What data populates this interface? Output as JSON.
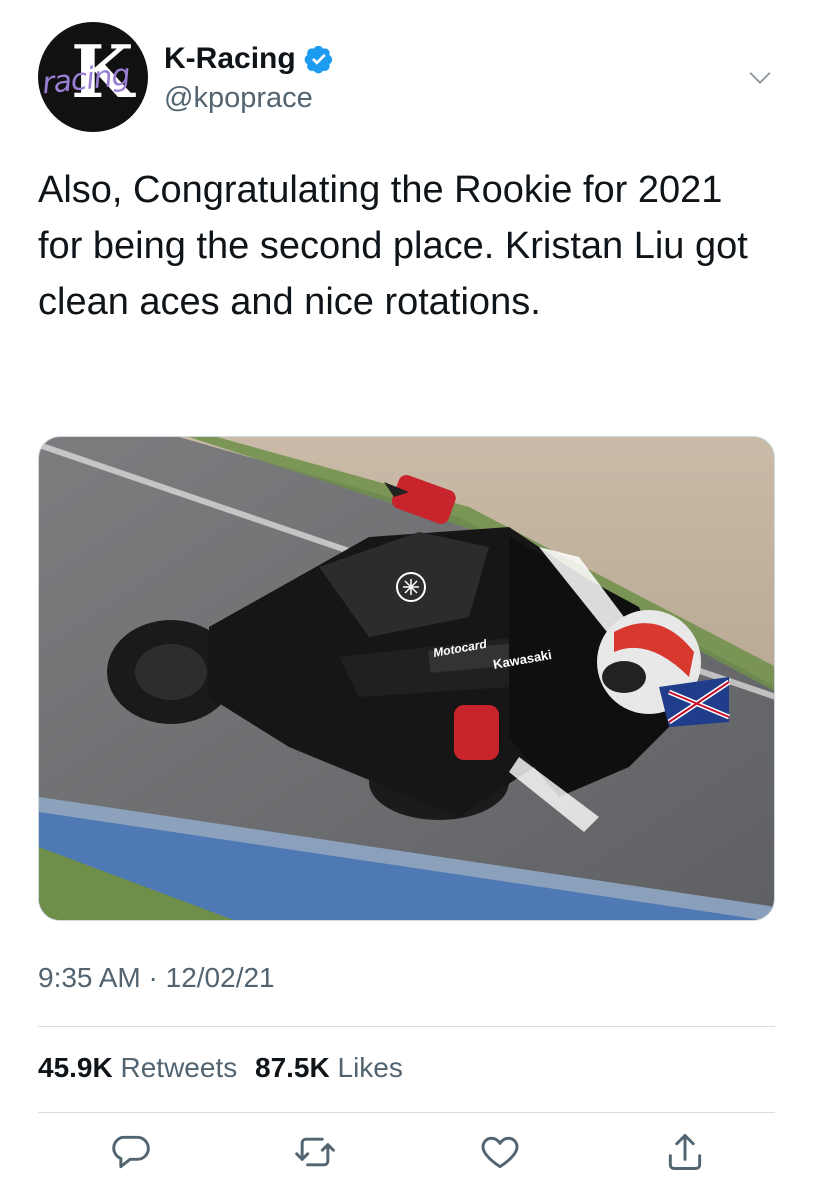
{
  "tweet": {
    "display_name": "K-Racing",
    "handle": "@kpoprace",
    "avatar_logo_letter": "K",
    "avatar_logo_word": "racing",
    "text": "Also, Congratulating the Rookie for 2021 for being the second place. Kristan Liu got clean aces and nice rotations.",
    "time": "9:35 AM",
    "date": "12/02/21",
    "retweets_count": "45.9K",
    "retweets_label": "Retweets",
    "likes_count": "87.5K",
    "likes_label": "Likes"
  },
  "icons": {
    "verified": "verified-badge-icon",
    "more": "chevron-down-icon",
    "reply": "reply-icon",
    "retweet": "retweet-icon",
    "like": "heart-icon",
    "share": "share-icon"
  },
  "colors": {
    "verified_blue": "#1d9bf0",
    "text_primary": "#0f1419",
    "text_secondary": "#536471",
    "divider": "#d9dee2"
  },
  "media": {
    "type": "photo",
    "subject": "motorcycle racer leaning into a corner"
  }
}
